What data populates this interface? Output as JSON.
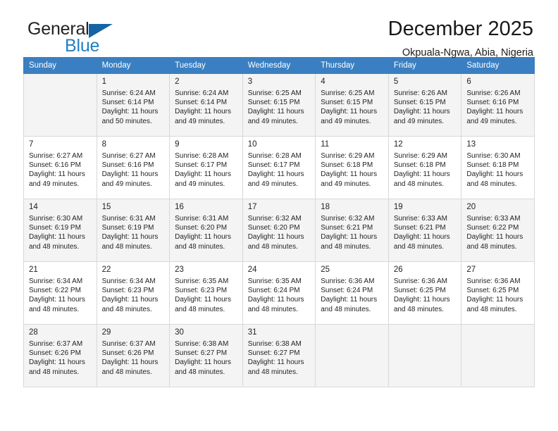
{
  "brand": {
    "word_general": "General",
    "word_blue": "Blue",
    "triangle_icon": "triangle-logo-icon"
  },
  "header": {
    "title": "December 2025",
    "subtitle": "Okpuala-Ngwa, Abia, Nigeria"
  },
  "colors": {
    "header_blue": "#3a7fc1",
    "brand_blue": "#1f7fc4",
    "logo_blue": "#1464a5",
    "band_gray": "#f4f4f4",
    "grid_gray": "#d8d8d8"
  },
  "weekdays": [
    "Sunday",
    "Monday",
    "Tuesday",
    "Wednesday",
    "Thursday",
    "Friday",
    "Saturday"
  ],
  "weeks": [
    [
      {
        "day": "",
        "sunrise": "",
        "sunset": "",
        "daylight1": "",
        "daylight2": ""
      },
      {
        "day": "1",
        "sunrise": "Sunrise: 6:24 AM",
        "sunset": "Sunset: 6:14 PM",
        "daylight1": "Daylight: 11 hours",
        "daylight2": "and 50 minutes."
      },
      {
        "day": "2",
        "sunrise": "Sunrise: 6:24 AM",
        "sunset": "Sunset: 6:14 PM",
        "daylight1": "Daylight: 11 hours",
        "daylight2": "and 49 minutes."
      },
      {
        "day": "3",
        "sunrise": "Sunrise: 6:25 AM",
        "sunset": "Sunset: 6:15 PM",
        "daylight1": "Daylight: 11 hours",
        "daylight2": "and 49 minutes."
      },
      {
        "day": "4",
        "sunrise": "Sunrise: 6:25 AM",
        "sunset": "Sunset: 6:15 PM",
        "daylight1": "Daylight: 11 hours",
        "daylight2": "and 49 minutes."
      },
      {
        "day": "5",
        "sunrise": "Sunrise: 6:26 AM",
        "sunset": "Sunset: 6:15 PM",
        "daylight1": "Daylight: 11 hours",
        "daylight2": "and 49 minutes."
      },
      {
        "day": "6",
        "sunrise": "Sunrise: 6:26 AM",
        "sunset": "Sunset: 6:16 PM",
        "daylight1": "Daylight: 11 hours",
        "daylight2": "and 49 minutes."
      }
    ],
    [
      {
        "day": "7",
        "sunrise": "Sunrise: 6:27 AM",
        "sunset": "Sunset: 6:16 PM",
        "daylight1": "Daylight: 11 hours",
        "daylight2": "and 49 minutes."
      },
      {
        "day": "8",
        "sunrise": "Sunrise: 6:27 AM",
        "sunset": "Sunset: 6:16 PM",
        "daylight1": "Daylight: 11 hours",
        "daylight2": "and 49 minutes."
      },
      {
        "day": "9",
        "sunrise": "Sunrise: 6:28 AM",
        "sunset": "Sunset: 6:17 PM",
        "daylight1": "Daylight: 11 hours",
        "daylight2": "and 49 minutes."
      },
      {
        "day": "10",
        "sunrise": "Sunrise: 6:28 AM",
        "sunset": "Sunset: 6:17 PM",
        "daylight1": "Daylight: 11 hours",
        "daylight2": "and 49 minutes."
      },
      {
        "day": "11",
        "sunrise": "Sunrise: 6:29 AM",
        "sunset": "Sunset: 6:18 PM",
        "daylight1": "Daylight: 11 hours",
        "daylight2": "and 49 minutes."
      },
      {
        "day": "12",
        "sunrise": "Sunrise: 6:29 AM",
        "sunset": "Sunset: 6:18 PM",
        "daylight1": "Daylight: 11 hours",
        "daylight2": "and 48 minutes."
      },
      {
        "day": "13",
        "sunrise": "Sunrise: 6:30 AM",
        "sunset": "Sunset: 6:18 PM",
        "daylight1": "Daylight: 11 hours",
        "daylight2": "and 48 minutes."
      }
    ],
    [
      {
        "day": "14",
        "sunrise": "Sunrise: 6:30 AM",
        "sunset": "Sunset: 6:19 PM",
        "daylight1": "Daylight: 11 hours",
        "daylight2": "and 48 minutes."
      },
      {
        "day": "15",
        "sunrise": "Sunrise: 6:31 AM",
        "sunset": "Sunset: 6:19 PM",
        "daylight1": "Daylight: 11 hours",
        "daylight2": "and 48 minutes."
      },
      {
        "day": "16",
        "sunrise": "Sunrise: 6:31 AM",
        "sunset": "Sunset: 6:20 PM",
        "daylight1": "Daylight: 11 hours",
        "daylight2": "and 48 minutes."
      },
      {
        "day": "17",
        "sunrise": "Sunrise: 6:32 AM",
        "sunset": "Sunset: 6:20 PM",
        "daylight1": "Daylight: 11 hours",
        "daylight2": "and 48 minutes."
      },
      {
        "day": "18",
        "sunrise": "Sunrise: 6:32 AM",
        "sunset": "Sunset: 6:21 PM",
        "daylight1": "Daylight: 11 hours",
        "daylight2": "and 48 minutes."
      },
      {
        "day": "19",
        "sunrise": "Sunrise: 6:33 AM",
        "sunset": "Sunset: 6:21 PM",
        "daylight1": "Daylight: 11 hours",
        "daylight2": "and 48 minutes."
      },
      {
        "day": "20",
        "sunrise": "Sunrise: 6:33 AM",
        "sunset": "Sunset: 6:22 PM",
        "daylight1": "Daylight: 11 hours",
        "daylight2": "and 48 minutes."
      }
    ],
    [
      {
        "day": "21",
        "sunrise": "Sunrise: 6:34 AM",
        "sunset": "Sunset: 6:22 PM",
        "daylight1": "Daylight: 11 hours",
        "daylight2": "and 48 minutes."
      },
      {
        "day": "22",
        "sunrise": "Sunrise: 6:34 AM",
        "sunset": "Sunset: 6:23 PM",
        "daylight1": "Daylight: 11 hours",
        "daylight2": "and 48 minutes."
      },
      {
        "day": "23",
        "sunrise": "Sunrise: 6:35 AM",
        "sunset": "Sunset: 6:23 PM",
        "daylight1": "Daylight: 11 hours",
        "daylight2": "and 48 minutes."
      },
      {
        "day": "24",
        "sunrise": "Sunrise: 6:35 AM",
        "sunset": "Sunset: 6:24 PM",
        "daylight1": "Daylight: 11 hours",
        "daylight2": "and 48 minutes."
      },
      {
        "day": "25",
        "sunrise": "Sunrise: 6:36 AM",
        "sunset": "Sunset: 6:24 PM",
        "daylight1": "Daylight: 11 hours",
        "daylight2": "and 48 minutes."
      },
      {
        "day": "26",
        "sunrise": "Sunrise: 6:36 AM",
        "sunset": "Sunset: 6:25 PM",
        "daylight1": "Daylight: 11 hours",
        "daylight2": "and 48 minutes."
      },
      {
        "day": "27",
        "sunrise": "Sunrise: 6:36 AM",
        "sunset": "Sunset: 6:25 PM",
        "daylight1": "Daylight: 11 hours",
        "daylight2": "and 48 minutes."
      }
    ],
    [
      {
        "day": "28",
        "sunrise": "Sunrise: 6:37 AM",
        "sunset": "Sunset: 6:26 PM",
        "daylight1": "Daylight: 11 hours",
        "daylight2": "and 48 minutes."
      },
      {
        "day": "29",
        "sunrise": "Sunrise: 6:37 AM",
        "sunset": "Sunset: 6:26 PM",
        "daylight1": "Daylight: 11 hours",
        "daylight2": "and 48 minutes."
      },
      {
        "day": "30",
        "sunrise": "Sunrise: 6:38 AM",
        "sunset": "Sunset: 6:27 PM",
        "daylight1": "Daylight: 11 hours",
        "daylight2": "and 48 minutes."
      },
      {
        "day": "31",
        "sunrise": "Sunrise: 6:38 AM",
        "sunset": "Sunset: 6:27 PM",
        "daylight1": "Daylight: 11 hours",
        "daylight2": "and 48 minutes."
      },
      {
        "day": "",
        "sunrise": "",
        "sunset": "",
        "daylight1": "",
        "daylight2": ""
      },
      {
        "day": "",
        "sunrise": "",
        "sunset": "",
        "daylight1": "",
        "daylight2": ""
      },
      {
        "day": "",
        "sunrise": "",
        "sunset": "",
        "daylight1": "",
        "daylight2": ""
      }
    ]
  ]
}
